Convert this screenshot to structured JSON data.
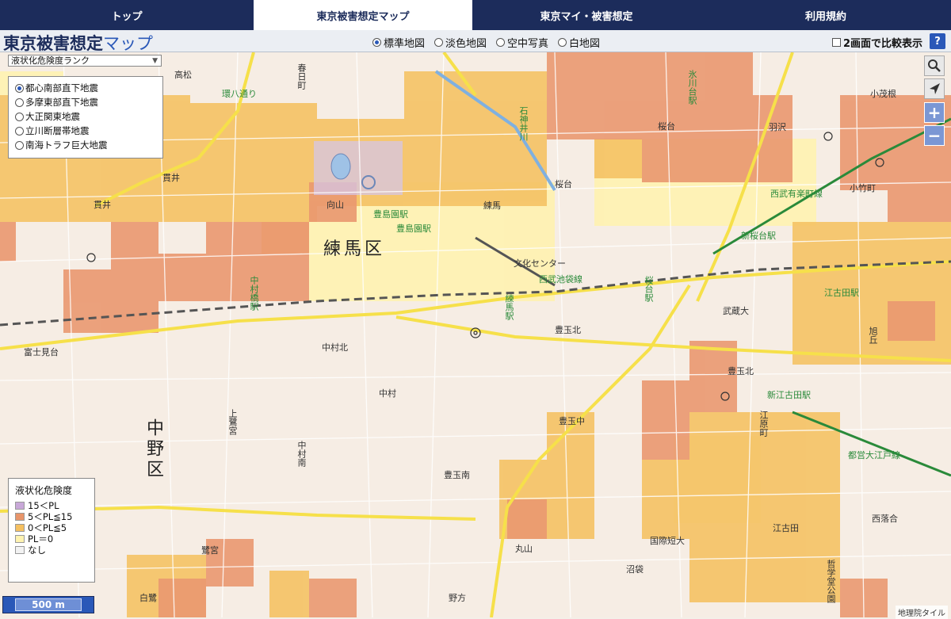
{
  "nav": {
    "tabs": [
      {
        "label": "トップ",
        "active": false
      },
      {
        "label": "東京被害想定マップ",
        "active": true
      },
      {
        "label": "東京マイ・被害想定",
        "active": false
      },
      {
        "label": "利用規約",
        "active": false
      }
    ]
  },
  "toolbar": {
    "logo_main": "東京被害想定",
    "logo_sub": "マップ",
    "basemaps": [
      {
        "label": "標準地図",
        "selected": true
      },
      {
        "label": "淡色地図",
        "selected": false
      },
      {
        "label": "空中写真",
        "selected": false
      },
      {
        "label": "白地図",
        "selected": false
      }
    ],
    "compare_label": "2画面で比較表示",
    "help_label": "?"
  },
  "layer_select": {
    "value": "液状化危険度ランク",
    "arrow": "▼"
  },
  "scenarios": [
    {
      "label": "都心南部直下地震",
      "selected": true
    },
    {
      "label": "多摩東部直下地震",
      "selected": false
    },
    {
      "label": "大正関東地震",
      "selected": false
    },
    {
      "label": "立川断層帯地震",
      "selected": false
    },
    {
      "label": "南海トラフ巨大地震",
      "selected": false
    }
  ],
  "legend": {
    "title": "液状化危険度",
    "items": [
      {
        "label": "15＜PL",
        "color": "#c8a8d8"
      },
      {
        "label": "5＜PL≦15",
        "color": "#e8956a"
      },
      {
        "label": "0＜PL≦5",
        "color": "#f5c060"
      },
      {
        "label": "PL＝0",
        "color": "#fff3b0"
      },
      {
        "label": "なし",
        "color": "#f2f2f2"
      }
    ]
  },
  "scalebar": "500 m",
  "attribution": "地理院タイル",
  "controls": {
    "search_icon": "search-icon",
    "locate_icon": "locate-arrow-icon",
    "zoom_in": "+",
    "zoom_out": "−"
  },
  "colors": {
    "nav_bg": "#1c2c5b",
    "accent": "#2a58b8",
    "risk_high": "#e8956a",
    "risk_mid": "#f5c060",
    "risk_low": "#fff3b0"
  },
  "map_labels": {
    "ward_nerima": "練馬区",
    "ward_nakano": "中野区",
    "toyotamaen_station": "豊島園駅",
    "nerima_station": "練馬駅",
    "sakuradai_station": "桜台駅",
    "ekoda_station": "江古田駅",
    "shinsakuradai_station": "新桜台駅",
    "shinekoda_station": "新江古田駅",
    "nakamurabashi_station": "中村橋駅",
    "hikawadai_station": "氷川台駅",
    "line_seibu_ikebukuro": "西武池袋線",
    "line_seibu_yurakucho": "西武有楽町線",
    "line_oedo": "都営大江戸線",
    "line_kanpachi": "環八通り",
    "ishigami_river": "石神井川",
    "bunka_center": "文化センター",
    "kokugakuin": "国際短大",
    "tetsugakudo": "哲学堂公園",
    "musashidai": "武蔵大",
    "toyotama_kita": "豊玉北",
    "nerima": "練馬",
    "sakuradai": "桜台",
    "nukui": "貫井",
    "koyamadai": "向山",
    "nakamura": "中村",
    "nakamura_kita": "中村北",
    "nakamura_minami": "中村南",
    "toyotama_naka": "豊玉中",
    "toyotama_minami": "豊玉南",
    "ekoda": "江古田",
    "egahara": "江原町",
    "kotake": "小竹町",
    "asahigaoka": "旭丘",
    "saginomiya": "鷺宮",
    "kamisaginomiya": "上鷺宮",
    "fujimidai": "富士見台",
    "nishiochiai": "西落合",
    "maruyama": "丸山",
    "numabukuro": "沼袋",
    "shirasagi": "白鷺",
    "nogata": "野方",
    "haneda": "羽沢",
    "kotakecho": "小茂根",
    "takamatsu": "高松",
    "kasuga": "春日町",
    "nerima_sakuradai": "桜台"
  }
}
